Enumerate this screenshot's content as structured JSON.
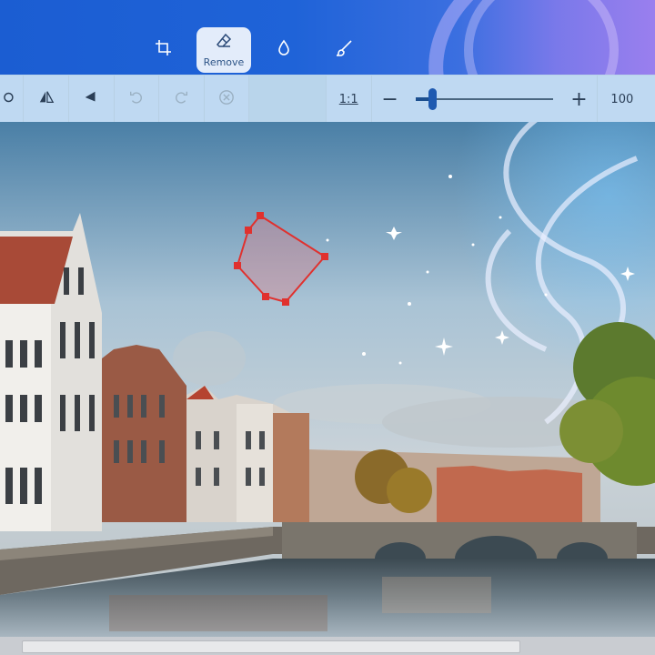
{
  "top_tools": [
    {
      "name": "crop",
      "icon": "crop-icon",
      "label": "",
      "active": false
    },
    {
      "name": "remove",
      "icon": "eraser-icon",
      "label": "Remove",
      "active": true
    },
    {
      "name": "blur",
      "icon": "droplet-icon",
      "label": "",
      "active": false
    },
    {
      "name": "brush",
      "icon": "brush-icon",
      "label": "",
      "active": false
    }
  ],
  "toolbar": {
    "buttons": [
      {
        "name": "rotate",
        "icon": "rotate-icon",
        "enabled": true
      },
      {
        "name": "flip-horizontal",
        "icon": "flip-horizontal-icon",
        "enabled": true
      },
      {
        "name": "flip-vertical",
        "icon": "flip-vertical-icon",
        "enabled": true
      },
      {
        "name": "undo",
        "icon": "undo-icon",
        "enabled": false
      },
      {
        "name": "redo",
        "icon": "redo-icon",
        "enabled": false
      },
      {
        "name": "clear",
        "icon": "clear-icon",
        "enabled": false
      }
    ],
    "ratio_label": "1:1",
    "zoom_minus": "−",
    "zoom_plus": "+",
    "zoom_value": "100",
    "zoom_level": 0.12
  },
  "selection": {
    "color": "#e0312e",
    "fill": "rgba(230,120,130,0.35)"
  },
  "colors": {
    "accent": "#1f5ab0",
    "top_bar": "#1b5dd2"
  }
}
